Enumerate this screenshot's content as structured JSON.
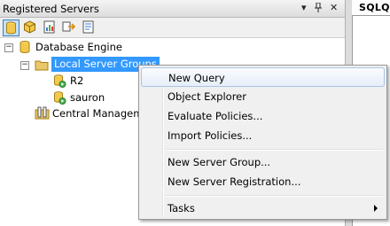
{
  "panel": {
    "title": "Registered Servers",
    "dropdown_glyph": "▾",
    "pin_glyph": "📌",
    "close_glyph": "✕"
  },
  "toolbar": {
    "items": [
      {
        "name": "database-engine-icon",
        "active": true
      },
      {
        "name": "analysis-services-icon",
        "active": false
      },
      {
        "name": "reporting-services-icon",
        "active": false
      },
      {
        "name": "integration-services-icon",
        "active": false
      },
      {
        "name": "compact-edition-icon",
        "active": false
      }
    ]
  },
  "tree": {
    "root": {
      "label": "Database Engine",
      "expander": "⊟"
    },
    "group": {
      "label": "Local Server Groups",
      "expander": "⊟"
    },
    "servers": [
      {
        "label": "R2"
      },
      {
        "label": "sauron"
      }
    ],
    "central": {
      "label": "Central Management Servers"
    }
  },
  "right_pane": {
    "tab_label": "SQLQ"
  },
  "context_menu": {
    "items": [
      {
        "label": "New Query",
        "highlighted": true
      },
      {
        "label": "Object Explorer"
      },
      {
        "label": "Evaluate Policies..."
      },
      {
        "label": "Import Policies..."
      },
      {
        "label": "New Server Group..."
      },
      {
        "label": "New Server Registration..."
      },
      {
        "label": "Tasks",
        "has_submenu": true
      }
    ]
  },
  "colors": {
    "selection": "#3399ff",
    "menu_bg": "#f0f0f0",
    "folder": "#e8c86a",
    "database": "#f2c94c",
    "server_green": "#4caf50"
  }
}
